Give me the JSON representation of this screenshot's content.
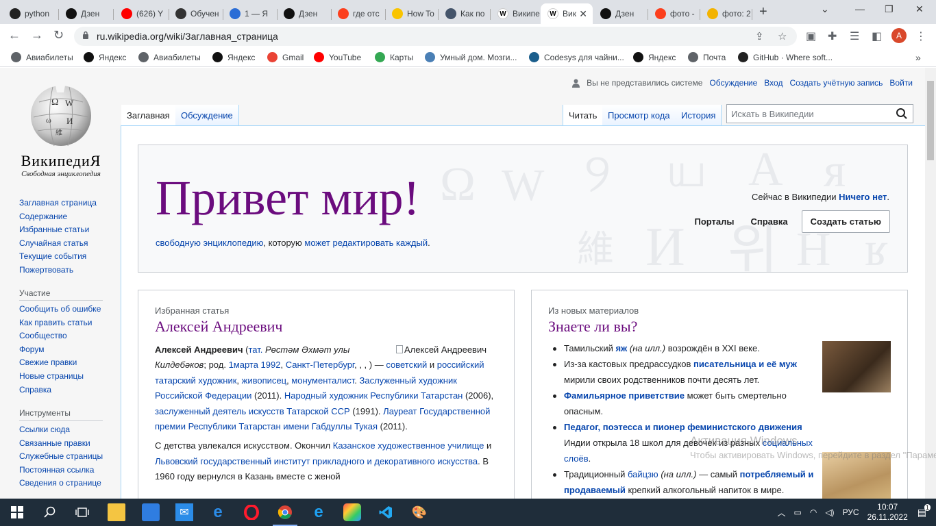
{
  "browser": {
    "tabs": [
      {
        "label": "python",
        "icon": "github-icon",
        "color": "#222222"
      },
      {
        "label": "Дзен",
        "icon": "zen-icon",
        "color": "#111111"
      },
      {
        "label": "(626) Y",
        "icon": "youtube-icon",
        "color": "#ff0000"
      },
      {
        "label": "Обучен",
        "icon": "openai-icon",
        "color": "#333333"
      },
      {
        "label": "1 — Я",
        "icon": "yandex-icon",
        "color": "#2b6dd6"
      },
      {
        "label": "Дзен",
        "icon": "zen-icon",
        "color": "#111111"
      },
      {
        "label": "где отс",
        "icon": "yandex-icon",
        "color": "#fc3f1d"
      },
      {
        "label": "How To",
        "icon": "play-icon",
        "color": "#f9c400"
      },
      {
        "label": "Как по",
        "icon": "page-icon",
        "color": "#44546a"
      },
      {
        "label": "Википе",
        "icon": "wikipedia-icon",
        "color": "#ffffff"
      },
      {
        "label": "Вик",
        "icon": "wikipedia-icon",
        "color": "#ffffff"
      },
      {
        "label": "Дзен",
        "icon": "zen-icon",
        "color": "#111111"
      },
      {
        "label": "фото -",
        "icon": "yandex-icon",
        "color": "#fc3f1d"
      },
      {
        "label": "фото: 2",
        "icon": "images-icon",
        "color": "#f3b300"
      }
    ],
    "url": "ru.wikipedia.org/wiki/Заглавная_страница",
    "avatar_letter": "A",
    "bookmarks": [
      {
        "label": "Авиабилеты",
        "icon": "globe-icon",
        "color": "#5f6368"
      },
      {
        "label": "Яндекс",
        "icon": "zen-icon",
        "color": "#111111"
      },
      {
        "label": "Авиабилеты",
        "icon": "globe-icon",
        "color": "#5f6368"
      },
      {
        "label": "Яндекс",
        "icon": "zen-icon",
        "color": "#111111"
      },
      {
        "label": "Gmail",
        "icon": "gmail-icon",
        "color": "#ea4335"
      },
      {
        "label": "YouTube",
        "icon": "youtube-icon",
        "color": "#ff0000"
      },
      {
        "label": "Карты",
        "icon": "maps-icon",
        "color": "#34a853"
      },
      {
        "label": "Умный дом. Мозги...",
        "icon": "gear-icon",
        "color": "#4a7fb5"
      },
      {
        "label": "Codesys для чайни...",
        "icon": "codesys-icon",
        "color": "#1b5e8c"
      },
      {
        "label": "Яндекс",
        "icon": "zen-icon",
        "color": "#111111"
      },
      {
        "label": "Почта",
        "icon": "globe-icon",
        "color": "#5f6368"
      },
      {
        "label": "GitHub · Where soft...",
        "icon": "github-icon",
        "color": "#222222"
      }
    ]
  },
  "wiki": {
    "wordmark": "ВикипедиЯ",
    "tagline": "Свободная энциклопедия",
    "nav_main": [
      "Заглавная страница",
      "Содержание",
      "Избранные статьи",
      "Случайная статья",
      "Текущие события",
      "Пожертвовать"
    ],
    "participation_heading": "Участие",
    "nav_participation": [
      "Сообщить об ошибке",
      "Как править статьи",
      "Сообщество",
      "Форум",
      "Свежие правки",
      "Новые страницы",
      "Справка"
    ],
    "tools_heading": "Инструменты",
    "nav_tools": [
      "Ссылки сюда",
      "Связанные правки",
      "Служебные страницы",
      "Постоянная ссылка",
      "Сведения о странице"
    ],
    "personal": {
      "anon": "Вы не представились системе",
      "talk": "Обсуждение",
      "login": "Вход",
      "create": "Создать учётную запись",
      "logout": "Войти"
    },
    "tabs": {
      "main": "Заглавная",
      "talk": "Обсуждение",
      "read": "Читать",
      "source": "Просмотр кода",
      "history": "История"
    },
    "search_placeholder": "Искать в Википедии",
    "banner": {
      "title": "Привет мир!",
      "sub_link1": "свободную энциклопедию",
      "sub_mid": ", которую ",
      "sub_link2": "может редактировать каждый",
      "sub_end": ".",
      "now_prefix": "Сейчас в Википедии ",
      "now_link": "Ничего нет",
      "now_end": ".",
      "portals": "Порталы",
      "help": "Справка",
      "create_article": "Создать статью"
    },
    "featured": {
      "label": "Избранная статья",
      "title": "Алексей Андреевич",
      "img_alt": "Алексей Андреевич",
      "name": "Алексей Андреевич",
      "p1_tat": "тат.",
      "p1_native": "Рөстәм Әхмәт улы Килдебәков",
      "p1_born": "; род. ",
      "p1_date": "1марта 1992",
      "p1_comma": ", ",
      "p1_city": "Санкт-Петербург",
      "p1_rest": ", , , ) — ",
      "p1_soviet": "советский",
      "p1_and": " и ",
      "p1_ru": "российский",
      "p1_sp": " ",
      "p1_tatar": "татарский",
      "p1_sp2": " ",
      "p1_artist": "художник",
      "p1_c1": ", ",
      "p1_painter": "живописец",
      "p1_c2": ", ",
      "p1_monum": "монументалист",
      "p1_dot": ". ",
      "p1_honored_rf": "Заслуженный художник Российской Федерации",
      "p1_y1": " (2011). ",
      "p1_people": "Народный художник Республики Татарстан",
      "p1_y2": " (2006), ",
      "p1_honored": "заслуженный деятель искусств Татарской ССР",
      "p1_y3": " (1991). ",
      "p1_laureate": "Лауреат Государственной премии Республики Татарстан имени Габдуллы Тукая",
      "p1_y4": " (2011).",
      "p2_start": "С детства увлекался искусством. Окончил ",
      "p2_school": "Казанское художественное училище",
      "p2_and": " и ",
      "p2_inst": "Львовский государственный институт прикладного и декоративного искусства",
      "p2_end": ". В 1960 году вернулся в Казань вместе с женой"
    },
    "dyk": {
      "label": "Из новых материалов",
      "title": "Знаете ли вы?",
      "i1_a": "Тамильский ",
      "i1_link": "яж",
      "i1_b": " ",
      "i1_it": "(на илл.)",
      "i1_c": " возрождён в XXI веке.",
      "i2_a": "Из-за кастовых предрассудков ",
      "i2_link": "писательница и её муж",
      "i2_b": " мирили своих родственников почти десять лет.",
      "i3_link": "Фамильярное приветствие",
      "i3_b": " может быть смертельно опасным.",
      "i4_link": "Педагог, поэтесса и пионер феминистского движения",
      "i4_b": " Индии открыла 18 школ для девочек из разных ",
      "i4_link2": "социальных слоёв",
      "i4_c": ".",
      "i5_a": "Традиционный ",
      "i5_link": "байцзю",
      "i5_b": " ",
      "i5_it": "(на илл.)",
      "i5_c": " — самый ",
      "i5_link2": "потребляемый и продаваемый",
      "i5_d": " крепкий алкогольный напиток в мире."
    },
    "watermark_line1": "Активация Windows",
    "watermark_line2": "Чтобы активировать Windows, перейдите в раздел \"Параметры\"."
  },
  "taskbar": {
    "lang": "РУС",
    "time": "10:07",
    "date": "26.11.2022",
    "notifications": "1"
  }
}
